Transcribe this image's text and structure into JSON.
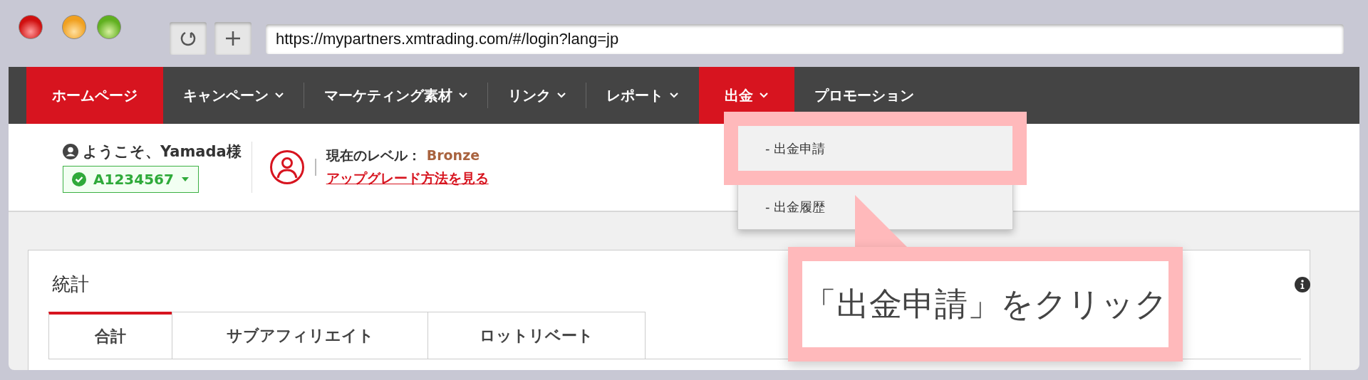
{
  "browser": {
    "url": "https://mypartners.xmtrading.com/#/login?lang=jp"
  },
  "nav": {
    "items": [
      {
        "label": "ホームページ",
        "selected": true,
        "caret": false
      },
      {
        "label": "キャンペーン",
        "selected": false,
        "caret": true
      },
      {
        "label": "マーケティング素材",
        "selected": false,
        "caret": true
      },
      {
        "label": "リンク",
        "selected": false,
        "caret": true
      },
      {
        "label": "レポート",
        "selected": false,
        "caret": true
      },
      {
        "label": "出金",
        "selected": true,
        "caret": true
      },
      {
        "label": "プロモーション",
        "selected": false,
        "caret": false
      }
    ]
  },
  "dropdown": {
    "items": [
      {
        "label": "- 出金申請",
        "highlighted": true
      },
      {
        "label": "- 出金履歴",
        "highlighted": false
      }
    ]
  },
  "user": {
    "greeting": "ようこそ、Yamada様",
    "account": "A1234567",
    "level_label": "現在のレベル：",
    "level": "Bronze",
    "upgrade_link": "アップグレード方法を見る"
  },
  "callout": {
    "text": "「出金申請」をクリック"
  },
  "stats": {
    "title": "統計",
    "tabs": [
      {
        "label": "合計",
        "selected": true
      },
      {
        "label": "サブアフィリエイト",
        "selected": false
      },
      {
        "label": "ロットリベート",
        "selected": false
      }
    ]
  }
}
